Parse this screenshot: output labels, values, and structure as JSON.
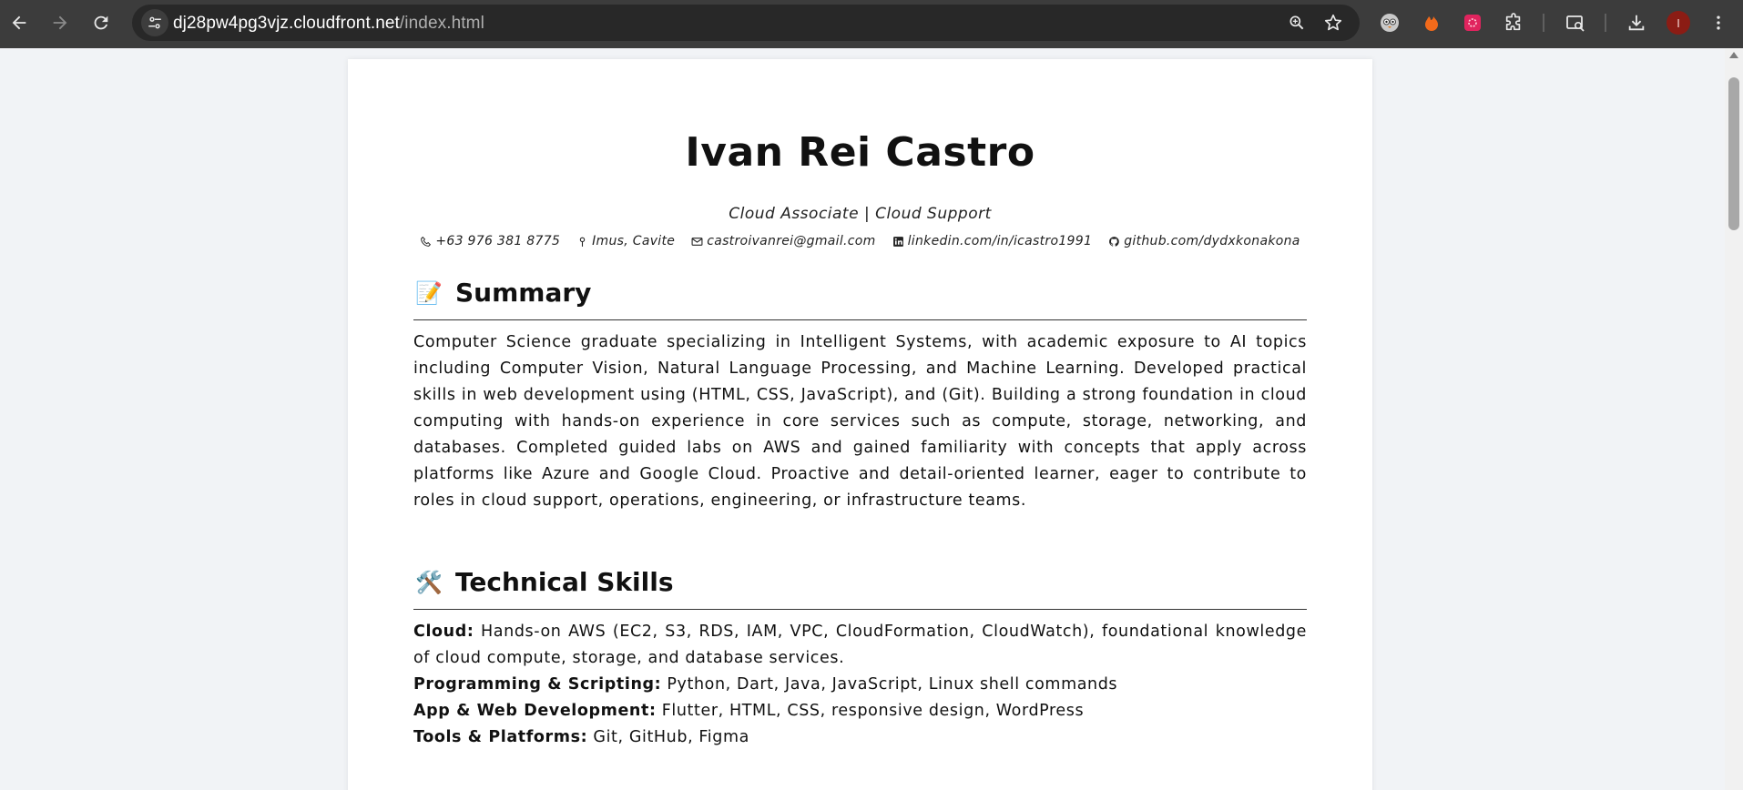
{
  "browser": {
    "url_host": "dj28pw4pg3vjz.cloudfront.net",
    "url_path": "/index.html",
    "avatar_letter": "I"
  },
  "resume": {
    "name": "Ivan Rei Castro",
    "tagline": "Cloud Associate | Cloud Support",
    "contacts": [
      {
        "icon": "phone-icon",
        "text": "+63 976 381 8775"
      },
      {
        "icon": "location-pin-icon",
        "text": "Imus, Cavite"
      },
      {
        "icon": "mail-icon",
        "text": "castroivanrei@gmail.com"
      },
      {
        "icon": "linkedin-icon",
        "text": "linkedin.com/in/icastro1991"
      },
      {
        "icon": "github-icon",
        "text": "github.com/dydxkonakona"
      }
    ],
    "summary": {
      "emoji": "📝",
      "title": "Summary",
      "text": "Computer Science graduate specializing in Intelligent Systems, with academic exposure to AI topics including Computer Vision, Natural Language Processing, and Machine Learning. Developed practical skills in web development using (HTML, CSS, JavaScript), and (Git). Building a strong foundation in cloud computing with hands-on experience in core services such as compute, storage, networking, and databases. Completed guided labs on AWS and gained familiarity with concepts that apply across platforms like Azure and Google Cloud. Proactive and detail-oriented learner, eager to contribute to roles in cloud support, operations, engineering, or infrastructure teams."
    },
    "skills": {
      "emoji": "🛠️",
      "title": "Technical Skills",
      "items": [
        {
          "label": "Cloud:",
          "value": "Hands-on AWS (EC2, S3, RDS, IAM, VPC, CloudFormation, CloudWatch), foundational knowledge of cloud compute, storage, and database services."
        },
        {
          "label": "Programming & Scripting:",
          "value": "Python, Dart, Java, JavaScript, Linux shell commands"
        },
        {
          "label": "App & Web Development:",
          "value": "Flutter, HTML, CSS, responsive design, WordPress"
        },
        {
          "label": "Tools & Platforms:",
          "value": "Git, GitHub, Figma"
        }
      ]
    }
  }
}
